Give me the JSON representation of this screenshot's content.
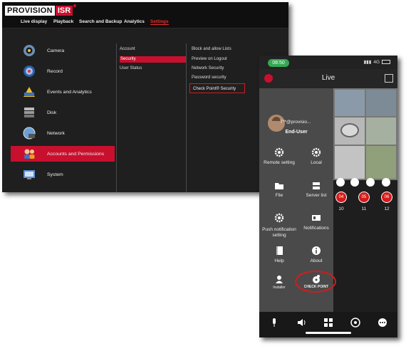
{
  "nvr": {
    "logo": {
      "brand": "PROVISION",
      "suffix": "ISR"
    },
    "nav": [
      "Live display",
      "Playback",
      "Search and Backup",
      "Analytics",
      "Settings"
    ],
    "nav_active": "Settings",
    "menu": [
      {
        "label": "Camera",
        "icon": "camera-icon"
      },
      {
        "label": "Record",
        "icon": "record-icon"
      },
      {
        "label": "Events and Analytics",
        "icon": "events-icon"
      },
      {
        "label": "Disk",
        "icon": "disk-icon"
      },
      {
        "label": "Network",
        "icon": "network-icon"
      },
      {
        "label": "Accounts and Permissions",
        "icon": "accounts-icon"
      },
      {
        "label": "System",
        "icon": "system-icon"
      }
    ],
    "menu_selected": "Accounts and Permissions",
    "submenu": [
      "Account",
      "Security",
      "User Status"
    ],
    "submenu_selected": "Security",
    "security_options": [
      "Block and allow Lists",
      "Preview on Logout",
      "Network Security",
      "Password security"
    ],
    "checkpoint_option": "Check Point® Security"
  },
  "phone": {
    "time": "08:50",
    "network": "4G",
    "title": "Live",
    "user": {
      "email": "T**@provisio...",
      "role": "End-User"
    },
    "drawer_items": [
      {
        "label": "Remote setting",
        "icon": "gear-icon"
      },
      {
        "label": "Local",
        "icon": "gear-icon"
      },
      {
        "label": "File",
        "icon": "folder-icon"
      },
      {
        "label": "Server list",
        "icon": "server-list-icon"
      },
      {
        "label": "Push notification setting",
        "icon": "gear-icon"
      },
      {
        "label": "Notifications",
        "icon": "notifications-icon"
      },
      {
        "label": "Help",
        "icon": "help-icon"
      },
      {
        "label": "About",
        "icon": "info-icon"
      },
      {
        "label": "Installer",
        "icon": "installer-icon"
      },
      {
        "label": "CHECK POINT",
        "icon": "checkpoint-icon"
      }
    ],
    "channels": [
      {
        "badge": "04",
        "number": "10"
      },
      {
        "badge": "05",
        "number": "11"
      },
      {
        "badge": "06",
        "number": "12"
      }
    ],
    "bottom_nav": [
      "microphone-icon",
      "speaker-icon",
      "grid-icon",
      "ptz-icon",
      "more-icon"
    ]
  }
}
